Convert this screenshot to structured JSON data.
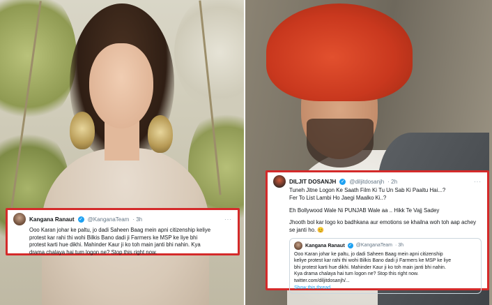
{
  "left_tweet": {
    "name": "Kangana Ranaut",
    "handle": "@KanganaTeam",
    "time": "· 3h",
    "lines": [
      "Ooo Karan johar ke paltu, jo dadi Saheen Baag mein apni citizenship keliye",
      "protest kar rahi thi wohi Bilkis Bano dadi ji Farmers ke MSP ke liye bhi",
      "protest karti hue dikhi. Mahinder Kaur ji ko toh main janti bhi nahin. Kya",
      "drama chalaya hai tum logon ne? Stop this right now."
    ]
  },
  "right_tweet": {
    "name": "DILJIT DOSANJH",
    "handle": "@diljitdosanjh",
    "time": "· 2h",
    "lines_1": [
      "Tuneh Jitne Logon Ke Saath Film Ki Tu Un Sab Ki Paaltu Hai...?",
      "Fer To List Lambi Ho Jaegi Maalko Ki..?"
    ],
    "line_2": "Eh Bollywood Wale Ni PUNJAB Wale aa .. Hikk Te Vajj Sadey",
    "lines_3": [
      "Jhooth bol kar logo ko badhkana aur emotions se khailna woh toh aap achey",
      "se janti ho. 😊"
    ],
    "quote": {
      "name": "Kangana Ranaut",
      "handle": "@KanganaTeam",
      "time": "· 3h",
      "lines": [
        "Ooo Karan johar ke paltu, jo dadi Saheen Baag mein apni citizenship",
        "keliye protest kar rahi thi wohi Bilkis Bano dadi ji Farmers ke MSP ke liye",
        "bhi protest karti hue dikhi. Mahinder Kaur ji ko toh main janti bhi nahin.",
        "Kya drama chalaya hai tum logon ne? Stop this right now.",
        "twitter.com/diljitdosanjh/..."
      ],
      "show_thread": "Show this thread"
    }
  },
  "colors": {
    "highlight_border": "#d42a2a",
    "verified_blue": "#1da1f2"
  }
}
